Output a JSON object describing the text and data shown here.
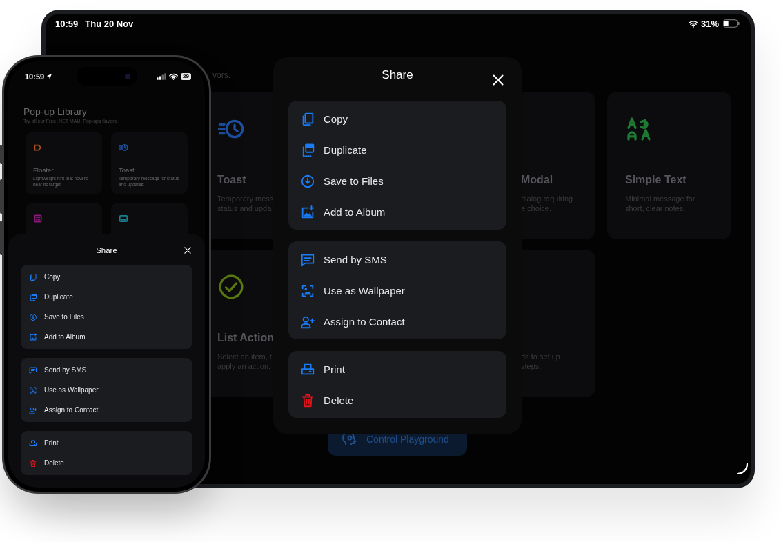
{
  "tablet": {
    "status_bar": {
      "time": "10:59",
      "date": "Thu 20 Nov",
      "battery": "31%"
    },
    "subtitle": "vors.",
    "cards": [
      {
        "kind": "clock",
        "color": "#1d4f9e",
        "title": "Toast",
        "lines": [
          "Temporary mess",
          "status and upda"
        ]
      },
      {
        "title": "Modal",
        "lines": [
          "dialog requiring",
          "e choice."
        ]
      },
      {
        "kind": "letters",
        "color": "#1d7a32",
        "title": "Simple Text",
        "lines": [
          "Minimal message for",
          "short, clear notes."
        ]
      },
      {
        "kind": "check",
        "color": "#5b7a10",
        "title": "List Action",
        "lines": [
          "Select an item, t",
          "apply an action."
        ]
      },
      {
        "lines": [
          "ds to set up",
          "steps."
        ]
      }
    ],
    "playground_button": "Control Playground",
    "share_dialog": {
      "title": "Share",
      "groups": [
        [
          {
            "label": "Copy",
            "kind": "copy",
            "destructive": false
          },
          {
            "label": "Duplicate",
            "kind": "duplicate",
            "destructive": false
          },
          {
            "label": "Save to Files",
            "kind": "download",
            "destructive": false
          },
          {
            "label": "Add to Album",
            "kind": "add-image",
            "destructive": false
          }
        ],
        [
          {
            "label": "Send by SMS",
            "kind": "message",
            "destructive": false
          },
          {
            "label": "Use as Wallpaper",
            "kind": "wallpaper",
            "destructive": false
          },
          {
            "label": "Assign to Contact",
            "kind": "add-person",
            "destructive": false
          }
        ],
        [
          {
            "label": "Print",
            "kind": "printer",
            "destructive": false
          },
          {
            "label": "Delete",
            "kind": "trash",
            "destructive": true
          }
        ]
      ]
    }
  },
  "phone": {
    "status_bar": {
      "time": "10:59",
      "battery": "29"
    },
    "title": "Pop-up Library",
    "subtitle": "Try all our Free .NET MAUI Pop-ups flavors.",
    "cards": [
      {
        "kind": "tag",
        "color": "#b3501b",
        "title": "Floater",
        "description": "Lightweight hint that hovers near its target."
      },
      {
        "kind": "clock",
        "color": "#1d4f9e",
        "title": "Toast",
        "description": "Temporary message for status and updates."
      },
      {
        "kind": "grid",
        "color": "#8a1a7a"
      },
      {
        "kind": "panel",
        "color": "#1a7f8f"
      }
    ],
    "share_sheet": {
      "title": "Share",
      "groups": [
        [
          {
            "label": "Copy",
            "kind": "copy",
            "destructive": false
          },
          {
            "label": "Duplicate",
            "kind": "duplicate",
            "destructive": false
          },
          {
            "label": "Save to Files",
            "kind": "download",
            "destructive": false
          },
          {
            "label": "Add to Album",
            "kind": "add-image",
            "destructive": false
          }
        ],
        [
          {
            "label": "Send by SMS",
            "kind": "message",
            "destructive": false
          },
          {
            "label": "Use as Wallpaper",
            "kind": "wallpaper",
            "destructive": false
          },
          {
            "label": "Assign to Contact",
            "kind": "add-person",
            "destructive": false
          }
        ],
        [
          {
            "label": "Print",
            "kind": "printer",
            "destructive": false
          },
          {
            "label": "Delete",
            "kind": "trash",
            "destructive": true
          }
        ]
      ]
    }
  }
}
